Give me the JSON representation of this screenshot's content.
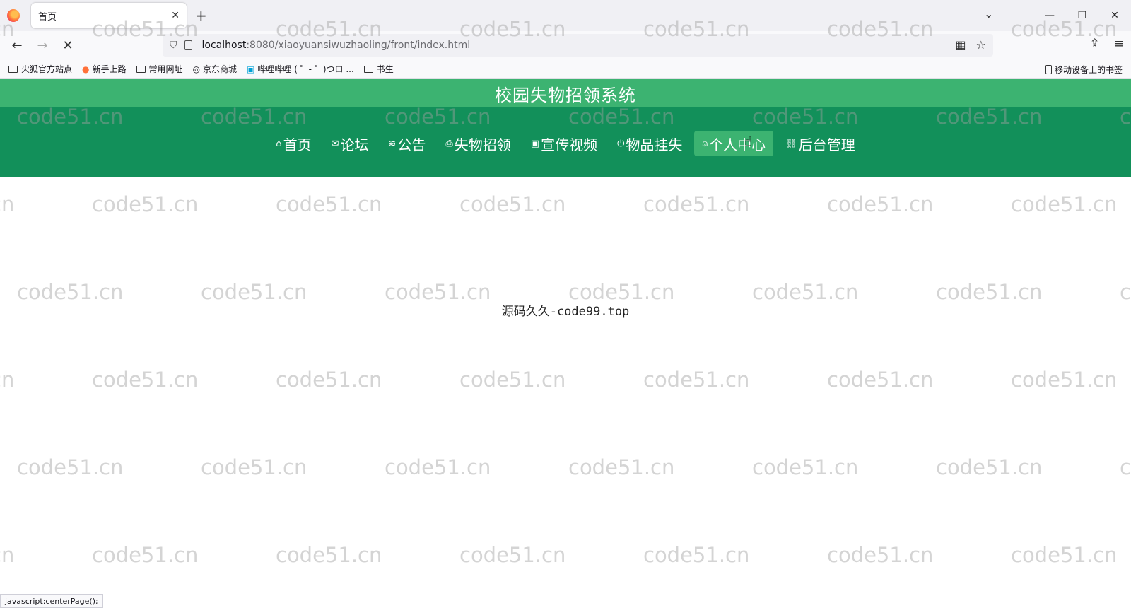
{
  "browser": {
    "tab_title": "首页",
    "tab_close": "✕",
    "new_tab": "+",
    "url_host": "localhost",
    "url_rest": ":8080/xiaoyuansiwuzhaoling/front/index.html",
    "bookmarks": [
      {
        "label": "火狐官方站点",
        "icon": "folder-icon"
      },
      {
        "label": "新手上路",
        "icon": "firefox-icon"
      },
      {
        "label": "常用网址",
        "icon": "folder-icon"
      },
      {
        "label": "京东商城",
        "icon": "globe-icon"
      },
      {
        "label": "哔哩哔哩 ( ゜- ゜)つロ ...",
        "icon": "bilibili-icon"
      },
      {
        "label": "书生",
        "icon": "folder-icon"
      }
    ],
    "mobile_bookmarks": "移动设备上的书签",
    "status_text": "javascript:centerPage();"
  },
  "site": {
    "title": "校园失物招领系统",
    "nav": [
      {
        "label": "首页",
        "icon": "home-icon",
        "glyph": "⌂",
        "active": false
      },
      {
        "label": "论坛",
        "icon": "mail-icon",
        "glyph": "✉",
        "active": false
      },
      {
        "label": "公告",
        "icon": "sliders-icon",
        "glyph": "≋",
        "active": false
      },
      {
        "label": "失物招领",
        "icon": "printer-icon",
        "glyph": "⎙",
        "active": false
      },
      {
        "label": "宣传视频",
        "icon": "gift-icon",
        "glyph": "▣",
        "active": false
      },
      {
        "label": "物品挂失",
        "icon": "power-icon",
        "glyph": "⏻",
        "active": false
      },
      {
        "label": "个人中心",
        "icon": "user-icon",
        "glyph": "⍝",
        "active": true
      },
      {
        "label": "后台管理",
        "icon": "link-icon",
        "glyph": "⛓",
        "active": false
      }
    ],
    "center_text": "源码久久-code99.top",
    "watermark": "code51.cn"
  },
  "colors": {
    "banner": "#3cb371",
    "nav_bg": "#12905a",
    "nav_active": "#3cb371"
  }
}
